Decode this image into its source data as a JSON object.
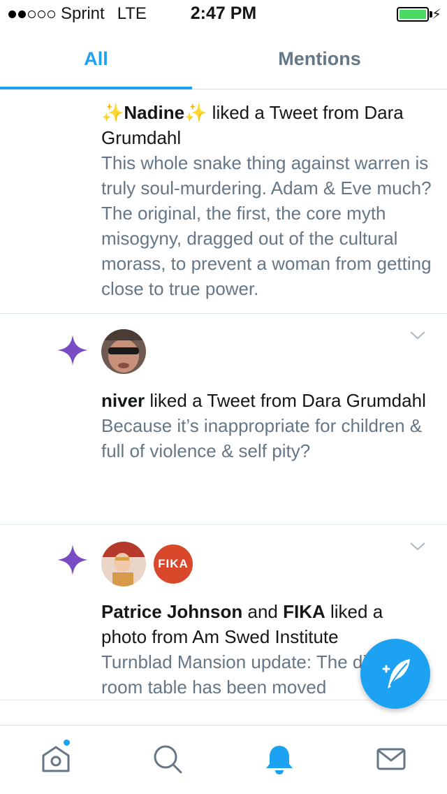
{
  "status_bar": {
    "carrier": "Sprint",
    "network": "LTE",
    "time": "2:47 PM",
    "battery_level": 1.0,
    "signal_bars_filled": 2
  },
  "tabs": [
    {
      "label": "All",
      "active": true
    },
    {
      "label": "Mentions",
      "active": false
    }
  ],
  "notifications": [
    {
      "actor_prefix": "✨",
      "actor": "Nadine",
      "actor_suffix": "✨",
      "action": " liked a Tweet from Dara Grumdahl",
      "text": "This whole snake thing against warren is truly soul-murdering. Adam & Eve much? The original, the first, the core myth misogyny, dragged out of the cultural morass, to prevent a woman from getting close to true power."
    },
    {
      "actor": "niver",
      "action": " liked a Tweet from Dara Grumdahl",
      "text": "Because it’s inappropriate for children & full of violence & self pity?"
    },
    {
      "actor": "Patrice Johnson",
      "connector": " and ",
      "actor2": "FIKA",
      "action": " liked a photo from Am Swed Institute",
      "text": "Turnblad Mansion update: The dining room table has been moved",
      "avatar2_label": "FIKA"
    }
  ],
  "colors": {
    "accent": "#1da1f2",
    "like_star": "#794bc4",
    "secondary_text": "#657786",
    "fika_avatar": "#d9482b"
  },
  "icons": {
    "fab": "compose-tweet-icon",
    "nav": [
      "home-icon",
      "search-icon",
      "notifications-bell-icon",
      "messages-envelope-icon"
    ]
  }
}
